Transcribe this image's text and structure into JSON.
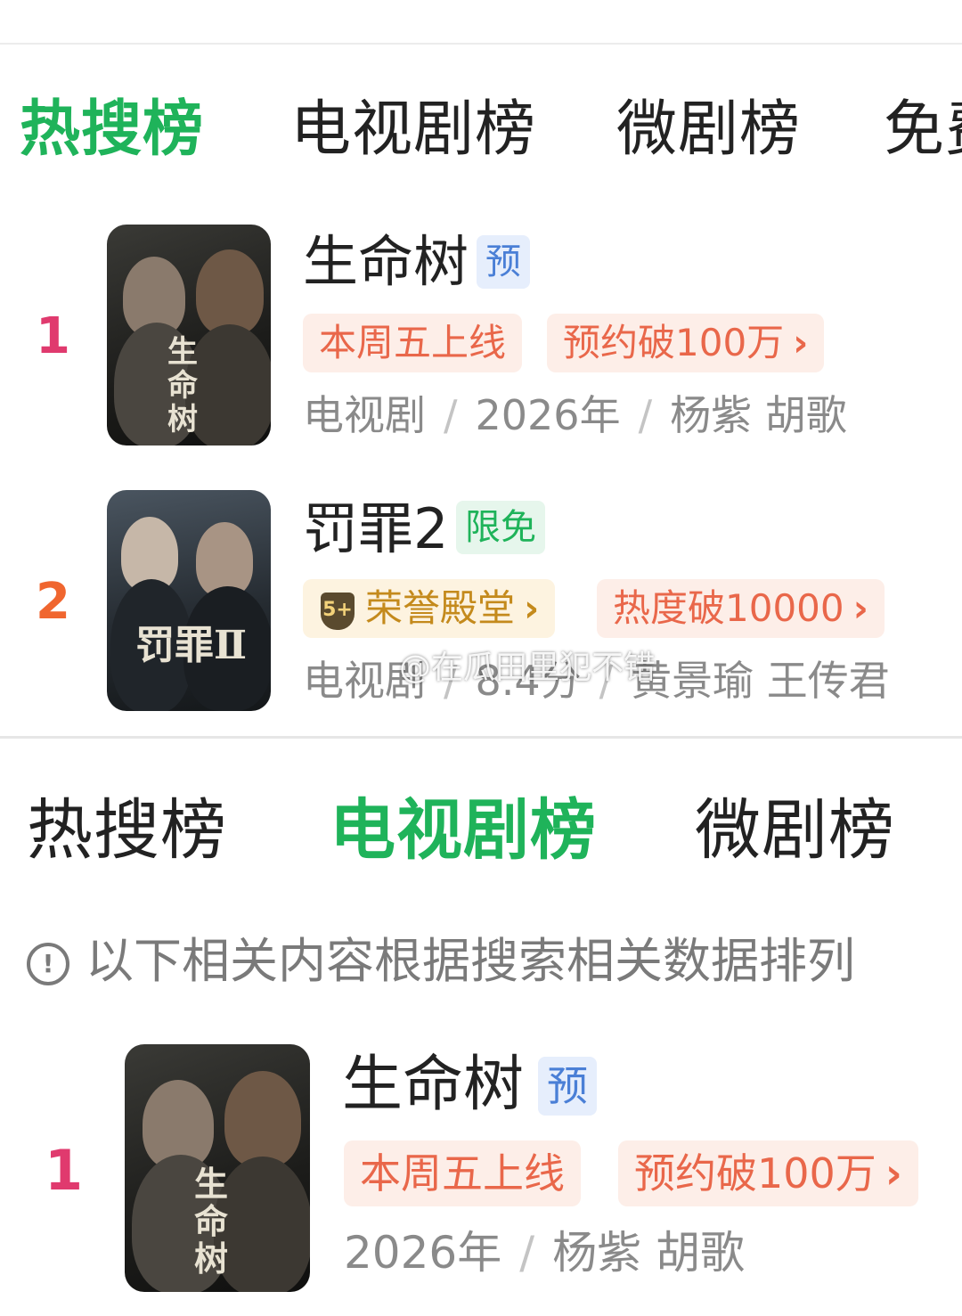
{
  "panel1": {
    "tabs": [
      "热搜榜",
      "电视剧榜",
      "微剧榜",
      "免费"
    ],
    "items": [
      {
        "rank": "1",
        "title": "生命树",
        "tag": "预",
        "badges": [
          "本周五上线",
          "预约破100万"
        ],
        "meta": [
          "电视剧",
          "2026年",
          "杨紫 胡歌"
        ],
        "poster_text": "生命树"
      },
      {
        "rank": "2",
        "title": "罚罪2",
        "tag": "限免",
        "badges": [
          "荣誉殿堂",
          "热度破10000"
        ],
        "honor_icon": "5+",
        "meta": [
          "电视剧",
          "8.4分",
          "黄景瑜 王传君"
        ],
        "poster_text": "罚罪Ⅱ"
      }
    ],
    "watermark": "@在瓜田里犯不错"
  },
  "panel2": {
    "tabs": [
      "热搜榜",
      "电视剧榜",
      "微剧榜"
    ],
    "notice": "以下相关内容根据搜索相关数据排列",
    "items": [
      {
        "rank": "1",
        "title": "生命树",
        "tag": "预",
        "badges": [
          "本周五上线",
          "预约破100万"
        ],
        "meta": [
          "2026年",
          "杨紫 胡歌"
        ],
        "poster_text": "生命树"
      }
    ]
  },
  "colors": {
    "active_tab": "#1fb35a",
    "rank_1": "#e03a6e",
    "rank_2": "#f0662f",
    "badge_orange": "#e9674a",
    "badge_gold": "#c48a1c",
    "tag_blue": "#4a7fd6",
    "tag_green": "#1fb35a"
  },
  "icons": [
    "chevron-right-icon",
    "honor-shield-icon",
    "info-icon"
  ]
}
